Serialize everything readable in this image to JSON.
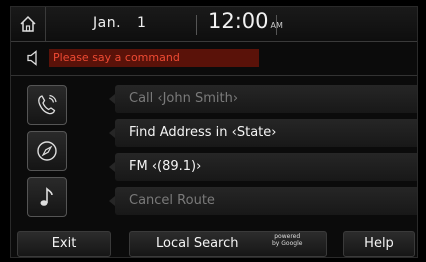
{
  "status": {
    "month": "Jan.",
    "day": "1",
    "time": "12:00",
    "ampm": "AM"
  },
  "voice": {
    "prompt": "Please say a command"
  },
  "commands": [
    {
      "label": "Call ‹John Smith›",
      "state": "dim"
    },
    {
      "label": "Find Address in ‹State›",
      "state": "bright"
    },
    {
      "label": "FM ‹(89.1)›",
      "state": "bright"
    },
    {
      "label": "Cancel Route",
      "state": "dim"
    }
  ],
  "side_icons": [
    "phone-icon",
    "compass-icon",
    "music-note-icon"
  ],
  "bottom": {
    "exit": "Exit",
    "local_search": "Local Search",
    "powered_line1": "powered",
    "powered_line2": "by Google",
    "help": "Help"
  }
}
